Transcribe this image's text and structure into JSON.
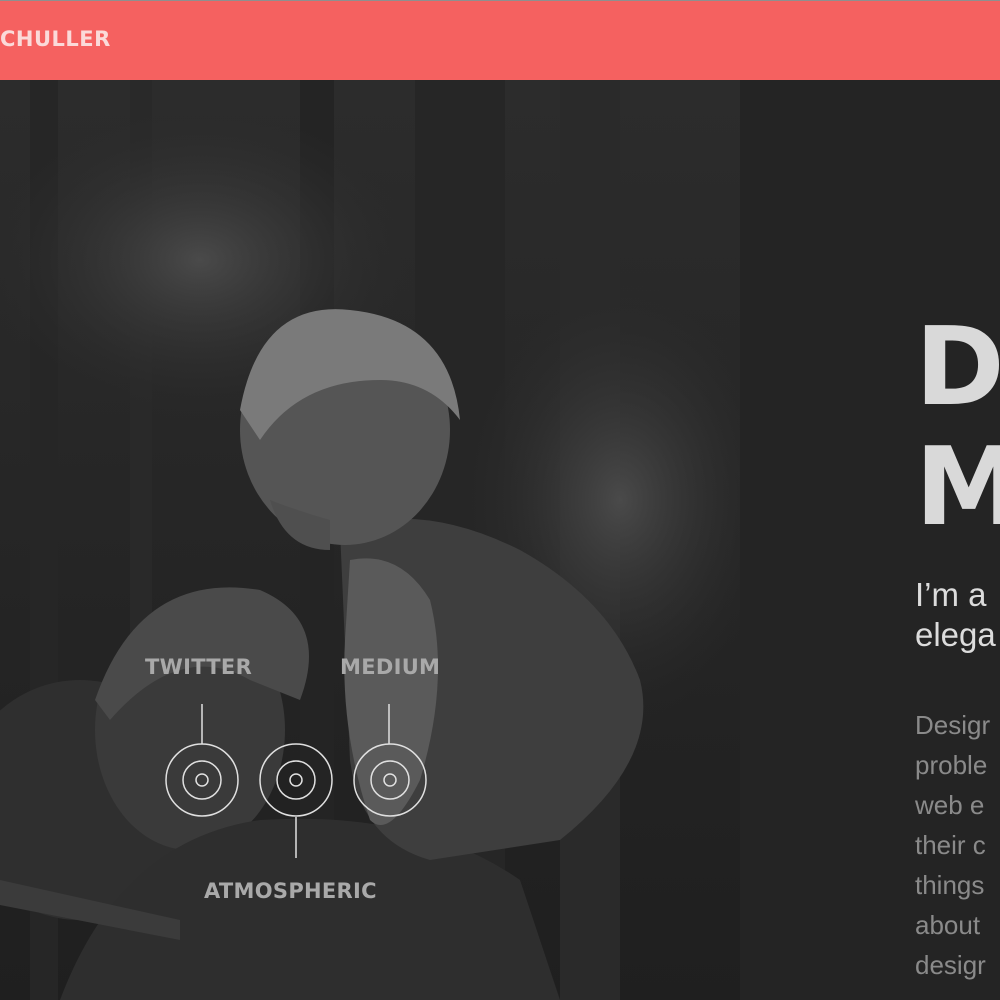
{
  "header": {
    "brand": "CHULLER",
    "background": "#f56160"
  },
  "hero": {
    "image_description": "dimmed black-and-white photo: father carrying child on shoulders in a forest"
  },
  "headline": {
    "line1": "D",
    "line2": "M"
  },
  "intro": {
    "lines": [
      "I’m a",
      "elega"
    ]
  },
  "body": {
    "lines": [
      "Desigr",
      "proble",
      "web e",
      "their c",
      "things",
      "about",
      "desigr"
    ]
  },
  "social": {
    "twitter": "TWITTER",
    "medium": "MEDIUM",
    "atmospheric": "ATMOSPHERIC"
  }
}
